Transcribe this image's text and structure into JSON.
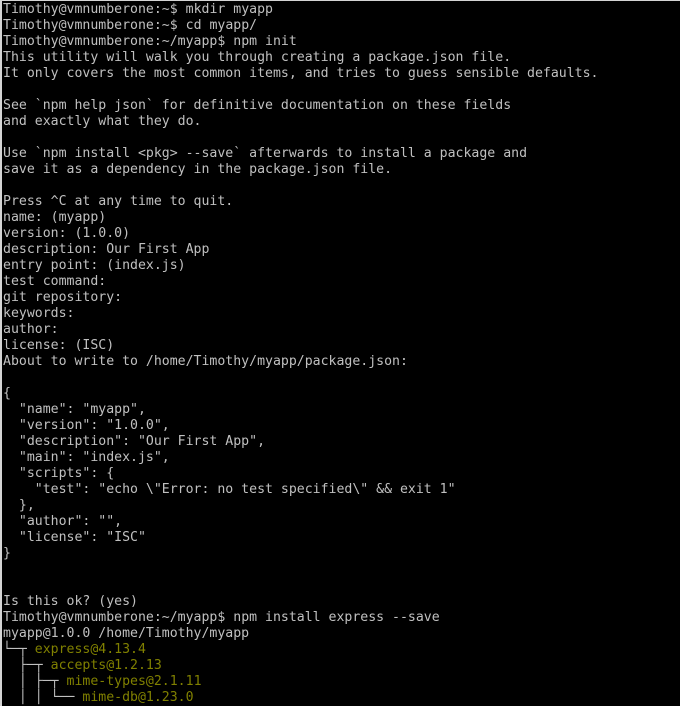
{
  "terminal": {
    "lines": [
      {
        "type": "cmd",
        "prompt": "Timothy@vmnumberone:~$ ",
        "command": "mkdir myapp"
      },
      {
        "type": "cmd",
        "prompt": "Timothy@vmnumberone:~$ ",
        "command": "cd myapp/"
      },
      {
        "type": "cmd",
        "prompt": "Timothy@vmnumberone:~/myapp$ ",
        "command": "npm init"
      },
      {
        "type": "out",
        "text": "This utility will walk you through creating a package.json file."
      },
      {
        "type": "out",
        "text": "It only covers the most common items, and tries to guess sensible defaults."
      },
      {
        "type": "out",
        "text": ""
      },
      {
        "type": "out",
        "text": "See `npm help json` for definitive documentation on these fields"
      },
      {
        "type": "out",
        "text": "and exactly what they do."
      },
      {
        "type": "out",
        "text": ""
      },
      {
        "type": "out",
        "text": "Use `npm install <pkg> --save` afterwards to install a package and"
      },
      {
        "type": "out",
        "text": "save it as a dependency in the package.json file."
      },
      {
        "type": "out",
        "text": ""
      },
      {
        "type": "out",
        "text": "Press ^C at any time to quit."
      },
      {
        "type": "out",
        "text": "name: (myapp)"
      },
      {
        "type": "out",
        "text": "version: (1.0.0)"
      },
      {
        "type": "out",
        "text": "description: Our First App"
      },
      {
        "type": "out",
        "text": "entry point: (index.js)"
      },
      {
        "type": "out",
        "text": "test command:"
      },
      {
        "type": "out",
        "text": "git repository:"
      },
      {
        "type": "out",
        "text": "keywords:"
      },
      {
        "type": "out",
        "text": "author:"
      },
      {
        "type": "out",
        "text": "license: (ISC)"
      },
      {
        "type": "out",
        "text": "About to write to /home/Timothy/myapp/package.json:"
      },
      {
        "type": "out",
        "text": ""
      },
      {
        "type": "out",
        "text": "{"
      },
      {
        "type": "out",
        "text": "  \"name\": \"myapp\","
      },
      {
        "type": "out",
        "text": "  \"version\": \"1.0.0\","
      },
      {
        "type": "out",
        "text": "  \"description\": \"Our First App\","
      },
      {
        "type": "out",
        "text": "  \"main\": \"index.js\","
      },
      {
        "type": "out",
        "text": "  \"scripts\": {"
      },
      {
        "type": "out",
        "text": "    \"test\": \"echo \\\"Error: no test specified\\\" && exit 1\""
      },
      {
        "type": "out",
        "text": "  },"
      },
      {
        "type": "out",
        "text": "  \"author\": \"\","
      },
      {
        "type": "out",
        "text": "  \"license\": \"ISC\""
      },
      {
        "type": "out",
        "text": "}"
      },
      {
        "type": "out",
        "text": ""
      },
      {
        "type": "out",
        "text": ""
      },
      {
        "type": "out",
        "text": "Is this ok? (yes)"
      },
      {
        "type": "cmd",
        "prompt": "Timothy@vmnumberone:~/myapp$ ",
        "command": "npm install express --save"
      },
      {
        "type": "out",
        "text": "myapp@1.0.0 /home/Timothy/myapp"
      },
      {
        "type": "tree",
        "tree": "└─┬ ",
        "pkg": "express@4.13.4"
      },
      {
        "type": "tree",
        "tree": "  ├─┬ ",
        "pkg": "accepts@1.2.13"
      },
      {
        "type": "tree",
        "tree": "  │ ├─┬ ",
        "pkg": "mime-types@2.1.11"
      },
      {
        "type": "tree",
        "tree": "  │ │ └── ",
        "pkg": "mime-db@1.23.0"
      }
    ]
  },
  "colors": {
    "background": "#000000",
    "text": "#c0c0c0",
    "package": "#808000"
  }
}
